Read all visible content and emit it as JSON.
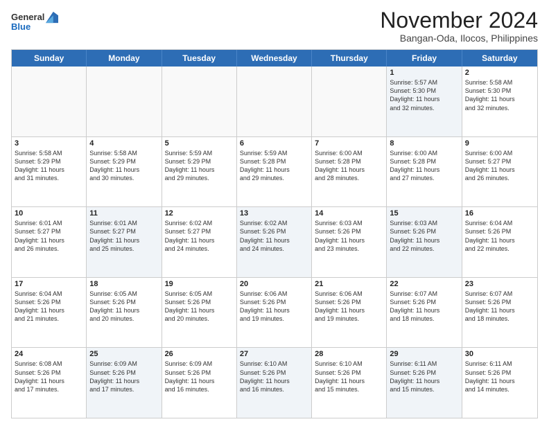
{
  "logo": {
    "general": "General",
    "blue": "Blue"
  },
  "title": "November 2024",
  "location": "Bangan-Oda, Ilocos, Philippines",
  "weekdays": [
    "Sunday",
    "Monday",
    "Tuesday",
    "Wednesday",
    "Thursday",
    "Friday",
    "Saturday"
  ],
  "rows": [
    [
      {
        "day": "",
        "info": ""
      },
      {
        "day": "",
        "info": ""
      },
      {
        "day": "",
        "info": ""
      },
      {
        "day": "",
        "info": ""
      },
      {
        "day": "",
        "info": ""
      },
      {
        "day": "1",
        "info": "Sunrise: 5:57 AM\nSunset: 5:30 PM\nDaylight: 11 hours\nand 32 minutes."
      },
      {
        "day": "2",
        "info": "Sunrise: 5:58 AM\nSunset: 5:30 PM\nDaylight: 11 hours\nand 32 minutes."
      }
    ],
    [
      {
        "day": "3",
        "info": "Sunrise: 5:58 AM\nSunset: 5:29 PM\nDaylight: 11 hours\nand 31 minutes."
      },
      {
        "day": "4",
        "info": "Sunrise: 5:58 AM\nSunset: 5:29 PM\nDaylight: 11 hours\nand 30 minutes."
      },
      {
        "day": "5",
        "info": "Sunrise: 5:59 AM\nSunset: 5:29 PM\nDaylight: 11 hours\nand 29 minutes."
      },
      {
        "day": "6",
        "info": "Sunrise: 5:59 AM\nSunset: 5:28 PM\nDaylight: 11 hours\nand 29 minutes."
      },
      {
        "day": "7",
        "info": "Sunrise: 6:00 AM\nSunset: 5:28 PM\nDaylight: 11 hours\nand 28 minutes."
      },
      {
        "day": "8",
        "info": "Sunrise: 6:00 AM\nSunset: 5:28 PM\nDaylight: 11 hours\nand 27 minutes."
      },
      {
        "day": "9",
        "info": "Sunrise: 6:00 AM\nSunset: 5:27 PM\nDaylight: 11 hours\nand 26 minutes."
      }
    ],
    [
      {
        "day": "10",
        "info": "Sunrise: 6:01 AM\nSunset: 5:27 PM\nDaylight: 11 hours\nand 26 minutes."
      },
      {
        "day": "11",
        "info": "Sunrise: 6:01 AM\nSunset: 5:27 PM\nDaylight: 11 hours\nand 25 minutes."
      },
      {
        "day": "12",
        "info": "Sunrise: 6:02 AM\nSunset: 5:27 PM\nDaylight: 11 hours\nand 24 minutes."
      },
      {
        "day": "13",
        "info": "Sunrise: 6:02 AM\nSunset: 5:26 PM\nDaylight: 11 hours\nand 24 minutes."
      },
      {
        "day": "14",
        "info": "Sunrise: 6:03 AM\nSunset: 5:26 PM\nDaylight: 11 hours\nand 23 minutes."
      },
      {
        "day": "15",
        "info": "Sunrise: 6:03 AM\nSunset: 5:26 PM\nDaylight: 11 hours\nand 22 minutes."
      },
      {
        "day": "16",
        "info": "Sunrise: 6:04 AM\nSunset: 5:26 PM\nDaylight: 11 hours\nand 22 minutes."
      }
    ],
    [
      {
        "day": "17",
        "info": "Sunrise: 6:04 AM\nSunset: 5:26 PM\nDaylight: 11 hours\nand 21 minutes."
      },
      {
        "day": "18",
        "info": "Sunrise: 6:05 AM\nSunset: 5:26 PM\nDaylight: 11 hours\nand 20 minutes."
      },
      {
        "day": "19",
        "info": "Sunrise: 6:05 AM\nSunset: 5:26 PM\nDaylight: 11 hours\nand 20 minutes."
      },
      {
        "day": "20",
        "info": "Sunrise: 6:06 AM\nSunset: 5:26 PM\nDaylight: 11 hours\nand 19 minutes."
      },
      {
        "day": "21",
        "info": "Sunrise: 6:06 AM\nSunset: 5:26 PM\nDaylight: 11 hours\nand 19 minutes."
      },
      {
        "day": "22",
        "info": "Sunrise: 6:07 AM\nSunset: 5:26 PM\nDaylight: 11 hours\nand 18 minutes."
      },
      {
        "day": "23",
        "info": "Sunrise: 6:07 AM\nSunset: 5:26 PM\nDaylight: 11 hours\nand 18 minutes."
      }
    ],
    [
      {
        "day": "24",
        "info": "Sunrise: 6:08 AM\nSunset: 5:26 PM\nDaylight: 11 hours\nand 17 minutes."
      },
      {
        "day": "25",
        "info": "Sunrise: 6:09 AM\nSunset: 5:26 PM\nDaylight: 11 hours\nand 17 minutes."
      },
      {
        "day": "26",
        "info": "Sunrise: 6:09 AM\nSunset: 5:26 PM\nDaylight: 11 hours\nand 16 minutes."
      },
      {
        "day": "27",
        "info": "Sunrise: 6:10 AM\nSunset: 5:26 PM\nDaylight: 11 hours\nand 16 minutes."
      },
      {
        "day": "28",
        "info": "Sunrise: 6:10 AM\nSunset: 5:26 PM\nDaylight: 11 hours\nand 15 minutes."
      },
      {
        "day": "29",
        "info": "Sunrise: 6:11 AM\nSunset: 5:26 PM\nDaylight: 11 hours\nand 15 minutes."
      },
      {
        "day": "30",
        "info": "Sunrise: 6:11 AM\nSunset: 5:26 PM\nDaylight: 11 hours\nand 14 minutes."
      }
    ]
  ]
}
